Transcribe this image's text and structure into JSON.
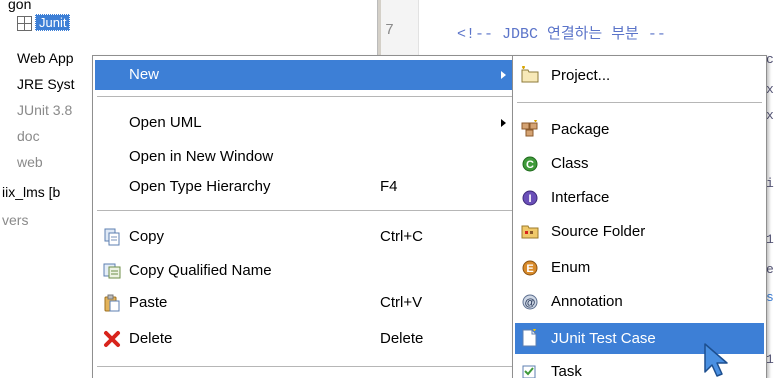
{
  "explorer": {
    "rows": [
      {
        "label": "gon"
      },
      {
        "label": "Junit"
      },
      {
        "label": "Web App"
      },
      {
        "label": "JRE Syst"
      },
      {
        "label": "JUnit 3.8"
      },
      {
        "label": "doc"
      },
      {
        "label": "web"
      },
      {
        "label": "iix_lms [b"
      },
      {
        "label": "vers"
      }
    ]
  },
  "editor": {
    "line_number": "7",
    "line_text": "<!-- JDBC 연결하는 부분 --",
    "edge_chars": [
      "c",
      "x",
      "x",
      "i",
      "1",
      "e",
      "s",
      "1"
    ]
  },
  "context_menu": {
    "items": [
      {
        "label": "New",
        "accel": "",
        "submenu": true
      },
      {
        "label": "Open UML",
        "accel": "",
        "submenu": true
      },
      {
        "label": "Open in New Window",
        "accel": ""
      },
      {
        "label": "Open Type Hierarchy",
        "accel": "F4"
      },
      {
        "label": "Copy",
        "accel": "Ctrl+C",
        "icon": "copy-icon"
      },
      {
        "label": "Copy Qualified Name",
        "accel": "",
        "icon": "copy-qualified-name-icon"
      },
      {
        "label": "Paste",
        "accel": "Ctrl+V",
        "icon": "paste-icon"
      },
      {
        "label": "Delete",
        "accel": "Delete",
        "icon": "delete-icon"
      }
    ]
  },
  "submenu": {
    "items": [
      {
        "label": "Project...",
        "icon": "project-icon"
      },
      {
        "label": "Package",
        "icon": "package-icon"
      },
      {
        "label": "Class",
        "icon": "class-icon"
      },
      {
        "label": "Interface",
        "icon": "interface-icon"
      },
      {
        "label": "Source Folder",
        "icon": "source-folder-icon"
      },
      {
        "label": "Enum",
        "icon": "enum-icon"
      },
      {
        "label": "Annotation",
        "icon": "annotation-icon"
      },
      {
        "label": "JUnit Test Case",
        "icon": "junit-test-case-icon"
      },
      {
        "label": "Task",
        "icon": "task-icon"
      }
    ]
  },
  "colors": {
    "selection": "#3d7fd6",
    "code_comment": "#5b74c9"
  }
}
